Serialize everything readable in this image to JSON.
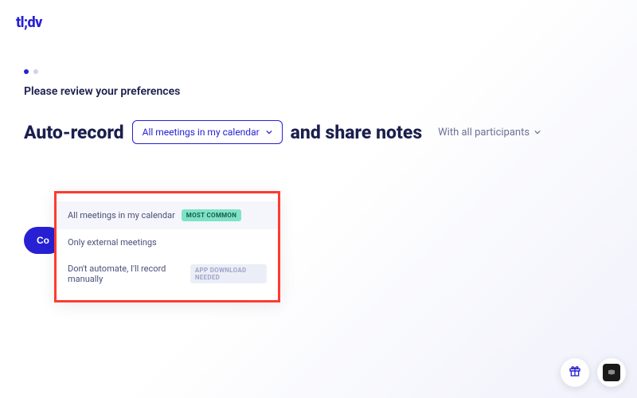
{
  "logo": "tl;dv",
  "stepper": {
    "total": 2,
    "active": 0
  },
  "subtitle": "Please review your preferences",
  "sentence": {
    "part1": "Auto-record",
    "part2": "and share notes"
  },
  "record_dropdown": {
    "selected": "All meetings in my calendar",
    "options": [
      {
        "label": "All meetings in my calendar",
        "badge": "MOST COMMON",
        "badge_type": "common"
      },
      {
        "label": "Only external meetings"
      },
      {
        "label": "Don't automate, I'll record manually",
        "badge": "APP DOWNLOAD NEEDED",
        "badge_type": "download"
      }
    ]
  },
  "share_dropdown": {
    "selected": "With all participants"
  },
  "confirm_button": "Co",
  "colors": {
    "brand": "#2720d4",
    "highlight_border": "#ff3b30",
    "badge_common_bg": "#7ee3c6"
  }
}
